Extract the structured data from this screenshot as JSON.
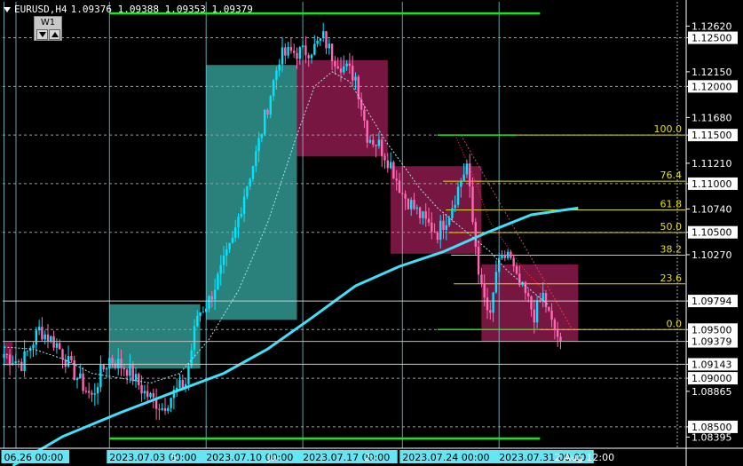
{
  "header": {
    "symbol": "EURUSD,H4",
    "ohlc": "1.09376 1.09388 1.09353 1.09379",
    "timeframe_label": "W1"
  },
  "colors": {
    "background": "#000000",
    "bull": "#00e5ff",
    "bear": "#ff69b4",
    "ma": "#40e0f8",
    "green_line": "#19e619",
    "fib": "#e0e000",
    "teal_box": "#2f8f8a",
    "maroon_box": "#8c1a4c",
    "grid_v": "#7fd8e8",
    "axis_label_bg": "#ffffff",
    "current_price_bg": "#ffffff"
  },
  "price_axis": {
    "labels": [
      {
        "text": "1.12620",
        "price": 1.1262,
        "boxed": false
      },
      {
        "text": "1.12500",
        "price": 1.125,
        "boxed": true
      },
      {
        "text": "1.12150",
        "price": 1.1215,
        "boxed": false
      },
      {
        "text": "1.12000",
        "price": 1.12,
        "boxed": true
      },
      {
        "text": "1.11680",
        "price": 1.1168,
        "boxed": false
      },
      {
        "text": "1.11500",
        "price": 1.115,
        "boxed": true
      },
      {
        "text": "1.11210",
        "price": 1.1121,
        "boxed": false
      },
      {
        "text": "1.11000",
        "price": 1.11,
        "boxed": true
      },
      {
        "text": "1.10740",
        "price": 1.1074,
        "boxed": false
      },
      {
        "text": "1.10500",
        "price": 1.105,
        "boxed": true
      },
      {
        "text": "1.10270",
        "price": 1.1027,
        "boxed": false
      },
      {
        "text": "1.09794",
        "price": 1.09794,
        "boxed": true
      },
      {
        "text": "1.09500",
        "price": 1.095,
        "boxed": true
      },
      {
        "text": "1.09379",
        "price": 1.09379,
        "boxed": true,
        "current": true
      },
      {
        "text": "1.09143",
        "price": 1.09143,
        "boxed": true
      },
      {
        "text": "1.09000",
        "price": 1.09,
        "boxed": true
      },
      {
        "text": "1.08865",
        "price": 1.08865,
        "boxed": false
      },
      {
        "text": "1.08500",
        "price": 1.085,
        "boxed": true
      },
      {
        "text": "1.08395",
        "price": 1.08395,
        "boxed": false
      }
    ],
    "dotted_levels": [
      1.125,
      1.12,
      1.115,
      1.11,
      1.105,
      1.095,
      1.09,
      1.085
    ]
  },
  "time_axis": {
    "labels": [
      {
        "text": "06.26 00:00",
        "bar": 0,
        "boxed": true
      },
      {
        "text": "2023.07.03 00:00",
        "bar": 36,
        "boxed": true
      },
      {
        "text": "5",
        "bar": 57,
        "boxed": false
      },
      {
        "text": "2023.07.10 00:00",
        "bar": 69,
        "boxed": true
      },
      {
        "text": "Ju",
        "bar": 90,
        "boxed": false
      },
      {
        "text": "2023.07.17 00:00",
        "bar": 102,
        "boxed": true
      },
      {
        "text": "2:",
        "bar": 123,
        "boxed": false
      },
      {
        "text": "2023.07.24 00:00",
        "bar": 136,
        "boxed": true
      },
      {
        "text": "2023.07.31 00:00",
        "bar": 169,
        "boxed": true
      },
      {
        "text": "2 Aug 12:00",
        "bar": 188,
        "boxed": false
      }
    ]
  },
  "fibonacci": {
    "levels": [
      {
        "label": "100.0",
        "price": 1.115
      },
      {
        "label": "76.4",
        "price": 1.11025
      },
      {
        "label": "61.8",
        "price": 1.1073
      },
      {
        "label": "50.0",
        "price": 1.10498
      },
      {
        "label": "38.2",
        "price": 1.10265
      },
      {
        "label": "23.6",
        "price": 1.0997
      },
      {
        "label": "0.0",
        "price": 1.095
      }
    ]
  },
  "green_levels": [
    {
      "price": 1.1275,
      "from_bar": 36,
      "to_bar": 183
    },
    {
      "price": 1.0838,
      "from_bar": 36,
      "to_bar": 183
    }
  ],
  "boxes": [
    {
      "kind": "teal",
      "from_bar": 36,
      "to_bar": 67,
      "high": 1.0976,
      "low": 1.091
    },
    {
      "kind": "teal",
      "from_bar": 69,
      "to_bar": 100,
      "high": 1.1222,
      "low": 1.096
    },
    {
      "kind": "maroon",
      "from_bar": 100,
      "to_bar": 131,
      "high": 1.1227,
      "low": 1.1128
    },
    {
      "kind": "maroon",
      "from_bar": 132,
      "to_bar": 163,
      "high": 1.1118,
      "low": 1.1028
    },
    {
      "kind": "maroon",
      "from_bar": 163,
      "to_bar": 196,
      "high": 1.1017,
      "low": 1.0938
    },
    {
      "kind": "maroon",
      "from_bar": 0,
      "to_bar": 3,
      "high": 1.0937,
      "low": 1.0913
    }
  ],
  "chart_data": {
    "type": "candlestick",
    "symbol": "EURUSD",
    "timeframe": "H4",
    "ylim": [
      1.0828,
      1.1287
    ],
    "last_price": 1.09379,
    "anchors": [
      [
        0,
        1.0925
      ],
      [
        6,
        1.0915
      ],
      [
        12,
        1.095
      ],
      [
        18,
        1.0935
      ],
      [
        24,
        1.0905
      ],
      [
        30,
        1.088
      ],
      [
        33,
        1.0905
      ],
      [
        36,
        1.092
      ],
      [
        42,
        1.091
      ],
      [
        48,
        1.0885
      ],
      [
        54,
        1.087
      ],
      [
        58,
        1.0885
      ],
      [
        62,
        1.0895
      ],
      [
        66,
        1.0965
      ],
      [
        70,
        1.098
      ],
      [
        74,
        1.101
      ],
      [
        78,
        1.104
      ],
      [
        82,
        1.109
      ],
      [
        86,
        1.113
      ],
      [
        90,
        1.118
      ],
      [
        94,
        1.123
      ],
      [
        98,
        1.1235
      ],
      [
        102,
        1.1235
      ],
      [
        106,
        1.124
      ],
      [
        109,
        1.125
      ],
      [
        112,
        1.1232
      ],
      [
        116,
        1.122
      ],
      [
        120,
        1.121
      ],
      [
        124,
        1.115
      ],
      [
        128,
        1.114
      ],
      [
        132,
        1.112
      ],
      [
        136,
        1.109
      ],
      [
        140,
        1.1075
      ],
      [
        144,
        1.106
      ],
      [
        148,
        1.105
      ],
      [
        152,
        1.107
      ],
      [
        155,
        1.1095
      ],
      [
        158,
        1.112
      ],
      [
        160,
        1.106
      ],
      [
        163,
        1.099
      ],
      [
        166,
        1.096
      ],
      [
        168,
        1.101
      ],
      [
        172,
        1.103
      ],
      [
        175,
        1.1
      ],
      [
        178,
        1.0985
      ],
      [
        181,
        1.0965
      ],
      [
        184,
        1.0985
      ],
      [
        187,
        1.0955
      ],
      [
        190,
        1.09379
      ]
    ],
    "ma_series": [
      [
        3,
        1.081
      ],
      [
        20,
        1.084
      ],
      [
        40,
        1.0865
      ],
      [
        60,
        1.0888
      ],
      [
        75,
        1.0905
      ],
      [
        90,
        1.093
      ],
      [
        105,
        1.0962
      ],
      [
        120,
        1.0995
      ],
      [
        135,
        1.1015
      ],
      [
        150,
        1.103
      ],
      [
        165,
        1.105
      ],
      [
        180,
        1.1068
      ],
      [
        196,
        1.1075
      ]
    ],
    "ma_dashed_series": [
      [
        0,
        1.0932
      ],
      [
        10,
        1.093
      ],
      [
        20,
        1.092
      ],
      [
        30,
        1.0905
      ],
      [
        40,
        1.09
      ],
      [
        50,
        1.0895
      ],
      [
        60,
        1.0905
      ],
      [
        70,
        1.094
      ],
      [
        80,
        1.099
      ],
      [
        90,
        1.106
      ],
      [
        100,
        1.115
      ],
      [
        106,
        1.12
      ],
      [
        112,
        1.1215
      ],
      [
        118,
        1.1205
      ],
      [
        124,
        1.1175
      ],
      [
        130,
        1.1145
      ],
      [
        136,
        1.112
      ],
      [
        142,
        1.1095
      ],
      [
        148,
        1.1075
      ],
      [
        154,
        1.106
      ],
      [
        160,
        1.1045
      ],
      [
        166,
        1.103
      ],
      [
        172,
        1.101
      ],
      [
        178,
        1.0995
      ],
      [
        186,
        1.0975
      ]
    ],
    "red_dotted_series": [
      [
        154,
        1.115
      ],
      [
        160,
        1.111
      ],
      [
        166,
        1.106
      ],
      [
        172,
        1.1035
      ],
      [
        178,
        1.101
      ],
      [
        186,
        1.0985
      ]
    ]
  }
}
